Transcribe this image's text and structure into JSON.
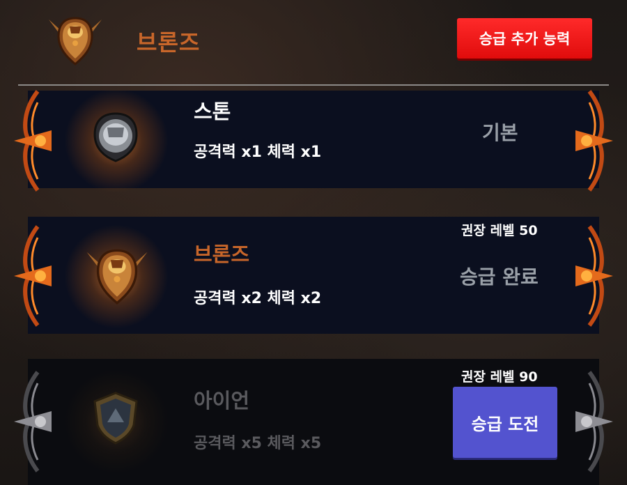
{
  "header": {
    "title": "브론즈",
    "promo_button_label": "승급 추가 능력"
  },
  "tiers": [
    {
      "name": "스톤",
      "stats": "공격력 x1  체력 x1",
      "status": "기본",
      "name_color": "#ffffff"
    },
    {
      "name": "브론즈",
      "stats": "공격력 x2  체력 x2",
      "status": "승급 완료",
      "recommended_level": "권장 레벨 50",
      "name_color": "#c8662a"
    },
    {
      "name": "아이언",
      "stats": "공격력 x5  체력 x5",
      "recommended_level": "권장 레벨 90",
      "action_label": "승급 도전",
      "name_color": "#5a5a5e"
    }
  ],
  "colors": {
    "accent_red": "#f01818",
    "accent_blue": "#5353cf",
    "bronze": "#c8662a",
    "row_bg": "#0b0f1f"
  }
}
